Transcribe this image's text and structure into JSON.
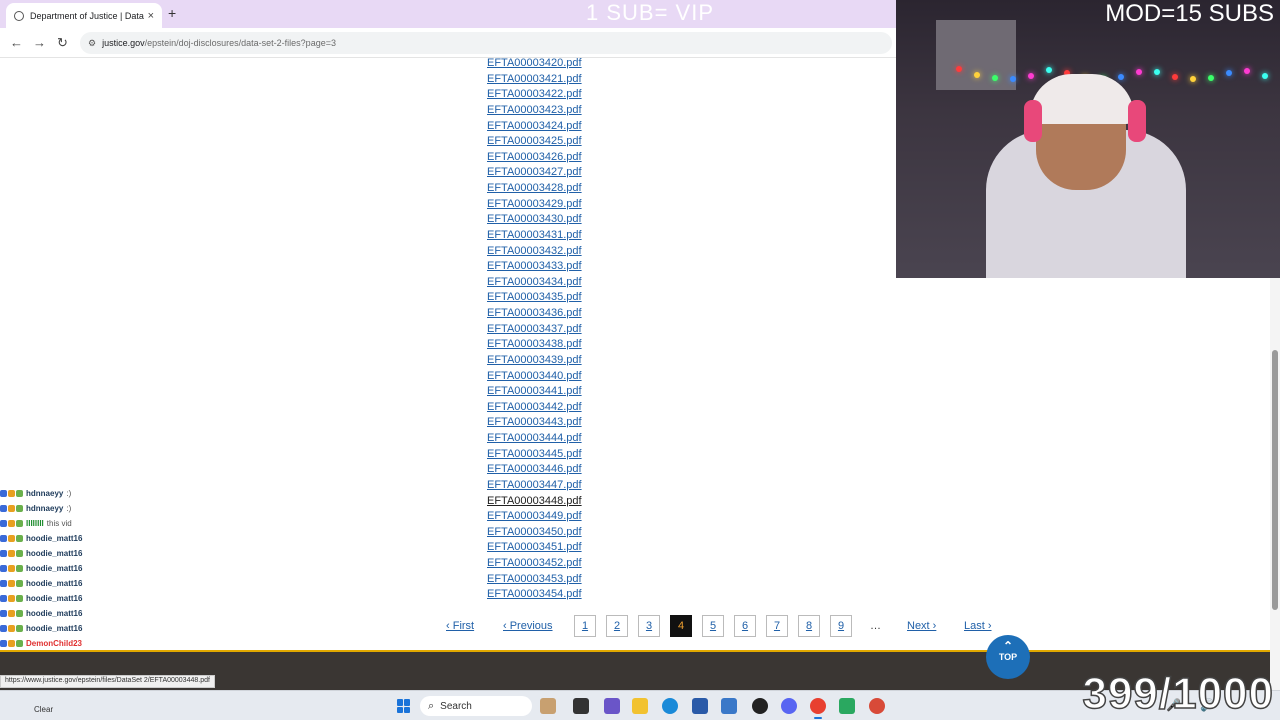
{
  "browser": {
    "tab_title": "Department of Justice | Data Se",
    "tab_close": "×",
    "new_tab": "+",
    "back": "←",
    "forward": "→",
    "reload": "↻",
    "site_icon": "⚙",
    "url_host": "justice.gov",
    "url_path": "/epstein/doj-disclosures/data-set-2-files?page=3"
  },
  "overlays": {
    "vip_text": "1 SUB= VIP",
    "mod_text": "MOD=15 SUBS",
    "counter": "399/1000"
  },
  "files": [
    {
      "name": "EFTA00003420.pdf"
    },
    {
      "name": "EFTA00003421.pdf"
    },
    {
      "name": "EFTA00003422.pdf"
    },
    {
      "name": "EFTA00003423.pdf"
    },
    {
      "name": "EFTA00003424.pdf"
    },
    {
      "name": "EFTA00003425.pdf"
    },
    {
      "name": "EFTA00003426.pdf"
    },
    {
      "name": "EFTA00003427.pdf"
    },
    {
      "name": "EFTA00003428.pdf"
    },
    {
      "name": "EFTA00003429.pdf"
    },
    {
      "name": "EFTA00003430.pdf"
    },
    {
      "name": "EFTA00003431.pdf"
    },
    {
      "name": "EFTA00003432.pdf"
    },
    {
      "name": "EFTA00003433.pdf"
    },
    {
      "name": "EFTA00003434.pdf"
    },
    {
      "name": "EFTA00003435.pdf"
    },
    {
      "name": "EFTA00003436.pdf"
    },
    {
      "name": "EFTA00003437.pdf"
    },
    {
      "name": "EFTA00003438.pdf"
    },
    {
      "name": "EFTA00003439.pdf"
    },
    {
      "name": "EFTA00003440.pdf"
    },
    {
      "name": "EFTA00003441.pdf"
    },
    {
      "name": "EFTA00003442.pdf"
    },
    {
      "name": "EFTA00003443.pdf"
    },
    {
      "name": "EFTA00003444.pdf"
    },
    {
      "name": "EFTA00003445.pdf"
    },
    {
      "name": "EFTA00003446.pdf"
    },
    {
      "name": "EFTA00003447.pdf"
    },
    {
      "name": "EFTA00003448.pdf",
      "hover": true
    },
    {
      "name": "EFTA00003449.pdf"
    },
    {
      "name": "EFTA00003450.pdf"
    },
    {
      "name": "EFTA00003451.pdf"
    },
    {
      "name": "EFTA00003452.pdf"
    },
    {
      "name": "EFTA00003453.pdf"
    },
    {
      "name": "EFTA00003454.pdf"
    }
  ],
  "pagination": {
    "first": "‹ First",
    "previous": "‹ Previous",
    "pages": [
      "1",
      "2",
      "3",
      "4",
      "5",
      "6",
      "7",
      "8",
      "9"
    ],
    "current": "4",
    "ellipsis": "…",
    "next": "Next ›",
    "last": "Last ›"
  },
  "top_button": {
    "arrow": "⌃",
    "label": "TOP"
  },
  "status_url": "https://www.justice.gov/epstein/files/DataSet 2/EFTA00003448.pdf",
  "chat": [
    {
      "user": "hdnnaeyy",
      "msg": ":)"
    },
    {
      "user": "hdnnaeyy",
      "msg": ":)"
    },
    {
      "user": "IIIIIIII",
      "msg": "this vid"
    },
    {
      "user": "hoodie_matt16",
      "msg": ""
    },
    {
      "user": "hoodie_matt16",
      "msg": ""
    },
    {
      "user": "hoodie_matt16",
      "msg": ""
    },
    {
      "user": "hoodie_matt16",
      "msg": ""
    },
    {
      "user": "hoodie_matt16",
      "msg": ""
    },
    {
      "user": "hoodie_matt16",
      "msg": ""
    },
    {
      "user": "hoodie_matt16",
      "msg": ""
    },
    {
      "user": "DemonChild23",
      "msg": ""
    }
  ],
  "taskbar": {
    "clear_label": "Clear",
    "search_icon": "⌕",
    "search_label": "Search",
    "tray": [
      "🎤",
      "🔊"
    ],
    "accent": "#1a73d9"
  },
  "colors": {
    "link": "#2060a8",
    "current_page_bg": "#111111",
    "current_page_fg": "#f0a030",
    "tabbar": "#e8d9f5",
    "top_button": "#1d6fb8"
  }
}
